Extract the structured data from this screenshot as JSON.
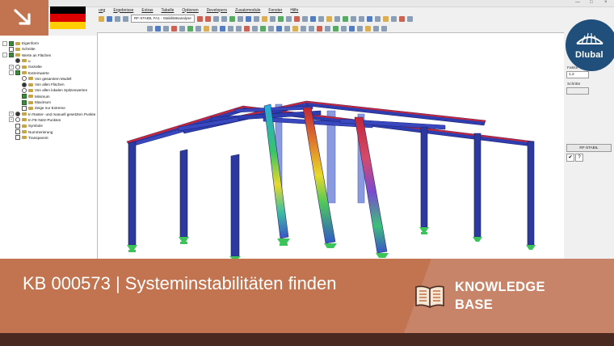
{
  "menu": [
    "ung",
    "Ergebnisse",
    "Extras",
    "Tabelle",
    "Optionen",
    "Developers",
    "Zusatzmodule",
    "Fenster",
    "Hilfe"
  ],
  "toolbar": {
    "module_select": "RF-STABIL FA1 - Stabilitätsanalyse"
  },
  "tree": {
    "items": [
      {
        "label": "Eigenform",
        "indent": 0,
        "ctl": "cb-on",
        "exp": "-"
      },
      {
        "label": "Schnitte",
        "indent": 0,
        "ctl": "cb",
        "exp": ""
      },
      {
        "label": "Werte an Flächen",
        "indent": 0,
        "ctl": "cb-on",
        "exp": "-"
      },
      {
        "label": "u",
        "indent": 1,
        "ctl": "rb-on",
        "exp": ""
      },
      {
        "label": "Gezielte",
        "indent": 1,
        "ctl": "rb",
        "exp": "+"
      },
      {
        "label": "Extremwerte",
        "indent": 1,
        "ctl": "cb-on",
        "exp": "-"
      },
      {
        "label": "Von gesamtem Modell",
        "indent": 2,
        "ctl": "rb",
        "exp": ""
      },
      {
        "label": "Von allen Flächen",
        "indent": 2,
        "ctl": "rb-on",
        "exp": ""
      },
      {
        "label": "Von allen lokalen Spitzenwerten",
        "indent": 2,
        "ctl": "rb",
        "exp": ""
      },
      {
        "label": "Minimum",
        "indent": 2,
        "ctl": "cb-on",
        "exp": ""
      },
      {
        "label": "Maximum",
        "indent": 2,
        "ctl": "cb-on",
        "exp": ""
      },
      {
        "label": "Zeige nur Extreme",
        "indent": 2,
        "ctl": "cb",
        "exp": ""
      },
      {
        "label": "In Raster- und manuell gesetzten Punkte",
        "indent": 1,
        "ctl": "rb-on",
        "exp": "+"
      },
      {
        "label": "In FE-Netz-Punkten",
        "indent": 1,
        "ctl": "rb",
        "exp": "+"
      },
      {
        "label": "Symbole",
        "indent": 1,
        "ctl": "cb",
        "exp": ""
      },
      {
        "label": "Nummerierung",
        "indent": 1,
        "ctl": "cb",
        "exp": ""
      },
      {
        "label": "Transparent",
        "indent": 1,
        "ctl": "cb",
        "exp": ""
      }
    ]
  },
  "right_panel": {
    "factor_label": "Faktor",
    "factor_value": "1.2",
    "step_label": "Schritte",
    "button": "RF-STABIL",
    "icon_b": "?"
  },
  "logo": {
    "text": "Dlubal"
  },
  "banner": {
    "title": "KB 000573 | Systeminstabilitäten finden",
    "kb_line1": "KNOWLEDGE",
    "kb_line2": "BASE"
  },
  "colors": {
    "banner": "#c2734f",
    "banner_dark": "#4a2a20",
    "logo_blue": "#1f4f7a",
    "member_blue": "#2c3aa0",
    "member_red": "#c2263a",
    "support_green": "#3cc45a"
  },
  "icons": [
    "arrow-down-right-icon",
    "germany-flag-icon",
    "book-icon",
    "dlubal-bridge-icon"
  ]
}
